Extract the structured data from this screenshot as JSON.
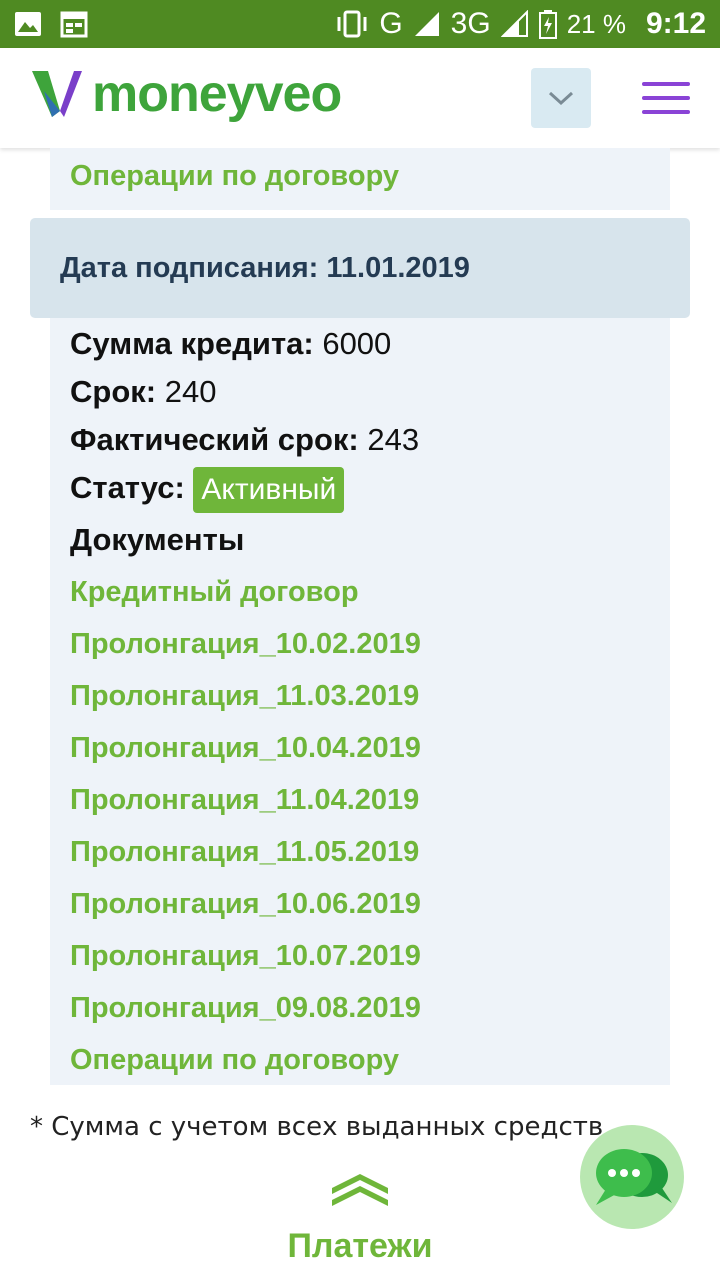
{
  "status_bar": {
    "network_type": "G",
    "network_type_2": "3G",
    "battery_percent": "21 %",
    "time": "9:12",
    "icons": [
      "image-icon",
      "calendar-icon",
      "vibrate-icon",
      "signal-icon",
      "battery-icon"
    ]
  },
  "header": {
    "brand_name": "moneyveo",
    "brand_color": "#3ea43b",
    "dropdown_icon": "chevron-down-icon",
    "menu_icon": "hamburger-menu-icon",
    "menu_color": "#8a43d6"
  },
  "previous_contract": {
    "operations_link": "Операции по договору"
  },
  "contract": {
    "date_label": "Дата подписания:",
    "date_value": "11.01.2019",
    "amount_label": "Сумма кредита:",
    "amount_value": "6000",
    "term_label": "Срок:",
    "term_value": "240",
    "actual_term_label": "Фактический срок:",
    "actual_term_value": "243",
    "status_label": "Статус:",
    "status_value": "Активный",
    "documents_title": "Документы",
    "documents": [
      "Кредитный договор",
      "Пролонгация_10.02.2019",
      "Пролонгация_11.03.2019",
      "Пролонгация_10.04.2019",
      "Пролонгация_11.04.2019",
      "Пролонгация_11.05.2019",
      "Пролонгация_10.06.2019",
      "Пролонгация_10.07.2019",
      "Пролонгация_09.08.2019"
    ],
    "operations_link": "Операции по договору"
  },
  "footnote": "* Сумма с учетом всех выданных средств",
  "payments": {
    "label": "Платежи",
    "icon": "double-chevron-up-icon"
  },
  "chat": {
    "icon": "chat-bubbles-icon"
  },
  "colors": {
    "accent_green": "#6fb63a",
    "status_bar": "#4f8a22",
    "date_header_bg": "#d7e4ec",
    "card_bg": "#eef3f9"
  }
}
